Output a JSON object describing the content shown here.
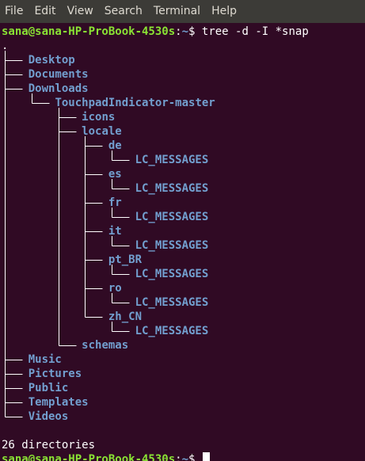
{
  "menu": [
    "File",
    "Edit",
    "View",
    "Search",
    "Terminal",
    "Help"
  ],
  "prompt": {
    "user_host": "sana@sana-HP-ProBook-4530s",
    "sep": ":",
    "path": "~",
    "sign": "$ "
  },
  "command": "tree -d -I *snap",
  "root": ".",
  "tree": [
    {
      "name": "Desktop",
      "depth": 0
    },
    {
      "name": "Documents",
      "depth": 0
    },
    {
      "name": "Downloads",
      "depth": 0
    },
    {
      "name": "TouchpadIndicator-master",
      "depth": 1
    },
    {
      "name": "icons",
      "depth": 2
    },
    {
      "name": "locale",
      "depth": 2
    },
    {
      "name": "de",
      "depth": 3
    },
    {
      "name": "LC_MESSAGES",
      "depth": 4
    },
    {
      "name": "es",
      "depth": 3
    },
    {
      "name": "LC_MESSAGES",
      "depth": 4
    },
    {
      "name": "fr",
      "depth": 3
    },
    {
      "name": "LC_MESSAGES",
      "depth": 4
    },
    {
      "name": "it",
      "depth": 3
    },
    {
      "name": "LC_MESSAGES",
      "depth": 4
    },
    {
      "name": "pt_BR",
      "depth": 3
    },
    {
      "name": "LC_MESSAGES",
      "depth": 4
    },
    {
      "name": "ro",
      "depth": 3
    },
    {
      "name": "LC_MESSAGES",
      "depth": 4
    },
    {
      "name": "zh_CN",
      "depth": 3
    },
    {
      "name": "LC_MESSAGES",
      "depth": 4
    },
    {
      "name": "schemas",
      "depth": 2
    },
    {
      "name": "Music",
      "depth": 0
    },
    {
      "name": "Pictures",
      "depth": 0
    },
    {
      "name": "Public",
      "depth": 0
    },
    {
      "name": "Templates",
      "depth": 0
    },
    {
      "name": "Videos",
      "depth": 0
    }
  ],
  "summary": "26 directories",
  "colors": {
    "background": "#300a24",
    "user": "#8ae234",
    "dir": "#729fcf",
    "text": "#ffffff"
  }
}
